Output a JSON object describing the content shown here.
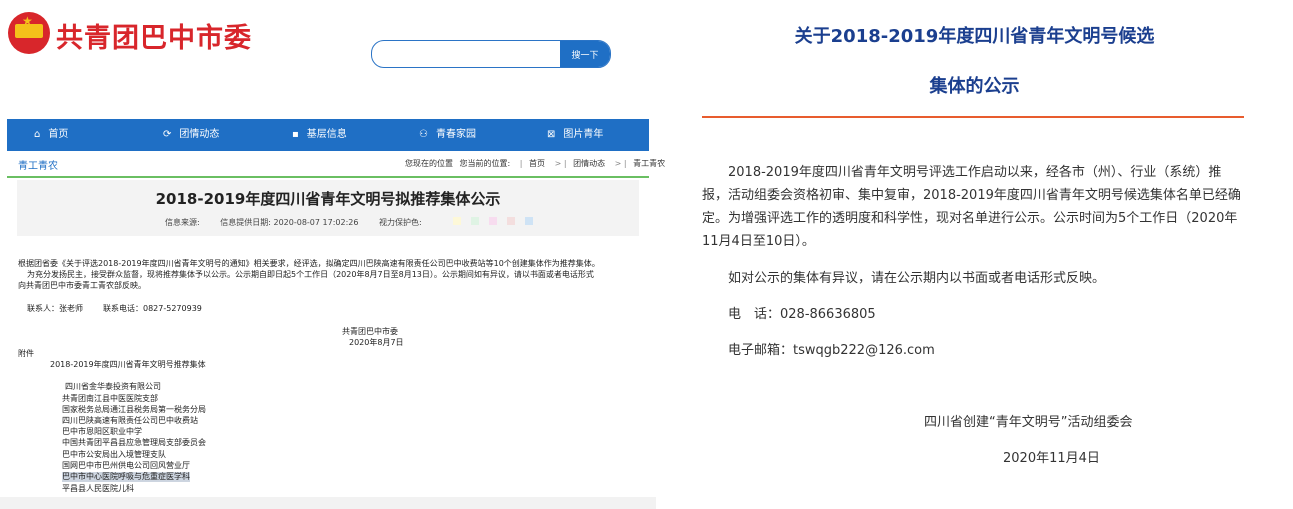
{
  "header": {
    "site_title": "共青团巴中市委",
    "search_placeholder": "",
    "search_button": "搜一下"
  },
  "nav": {
    "items": [
      {
        "icon": "home-icon",
        "label": "首页"
      },
      {
        "icon": "refresh-icon",
        "label": "团情动态"
      },
      {
        "icon": "list-icon",
        "label": "基层信息"
      },
      {
        "icon": "people-icon",
        "label": "青春家园"
      },
      {
        "icon": "image-icon",
        "label": "图片青年"
      }
    ]
  },
  "breadcrumb": {
    "section": "青工青农",
    "location_label": "您现在的位置",
    "current_label": "您当前的位置:",
    "items": [
      "首页",
      "团情动态",
      "青工青农"
    ]
  },
  "article": {
    "title": "2018-2019年度四川省青年文明号拟推荐集体公示",
    "source_label": "信息来源:",
    "time_label": "信息提供日期: 2020-08-07 17:02:26",
    "eye_label": "视力保护色:",
    "eye_colors": [
      "#fdf8d8",
      "#dff3e4",
      "#f7dcef",
      "#f3dede",
      "#cfe3f5"
    ],
    "paragraphs": [
      "根据团省委《关于评选2018-2019年度四川省青年文明号的通知》相关要求，经评选，拟确定四川巴陕高速有限责任公司巴中收费站等10个创建集体作为推荐集体。",
      "为充分发扬民主，接受群众监督，现将推荐集体予以公示。公示期自即日起5个工作日（2020年8月7日至8月13日）。公示期间如有异议，请以书面或者电话形式",
      "向共青团巴中市委青工青农部反映。"
    ],
    "contact": "联系人：张老师",
    "phone": "联系电话：0827-5270939",
    "signature": "共青团巴中市委",
    "date": "2020年8月7日",
    "attachment_label": "附件",
    "attachment_title": "2018-2019年度四川省青年文明号推荐集体",
    "collectives": [
      "四川省金华泰投资有限公司",
      "共青团南江县中医医院支部",
      "国家税务总局通江县税务局第一税务分局",
      "四川巴陕高速有限责任公司巴中收费站",
      "巴中市恩阳区职业中学",
      "中国共青团平昌县应急管理局支部委员会",
      "巴中市公安局出入境管理支队",
      "国网巴中市巴州供电公司回风营业厅",
      "巴中市中心医院呼吸与危重症医学科",
      "平昌县人民医院儿科"
    ]
  },
  "notice": {
    "title_line1": "关于2018-2019年度四川省青年文明号候选",
    "title_line2": "集体的公示",
    "para1": "2018-2019年度四川省青年文明号评选工作启动以来，经各市（州）、行业（系统）推报，活动组委会资格初审、集中复审，2018-2019年度四川省青年文明号候选集体名单已经确定。为增强评选工作的透明度和科学性，现对名单进行公示。公示时间为5个工作日（2020年11月4日至10日）。",
    "para2": "如对公示的集体有异议，请在公示期内以书面或者电话形式反映。",
    "phone": "电　话：028-86636805",
    "email": "电子邮箱：tswqgb222@126.com",
    "org": "四川省创建“青年文明号”活动组委会",
    "date": "2020年11月4日"
  }
}
